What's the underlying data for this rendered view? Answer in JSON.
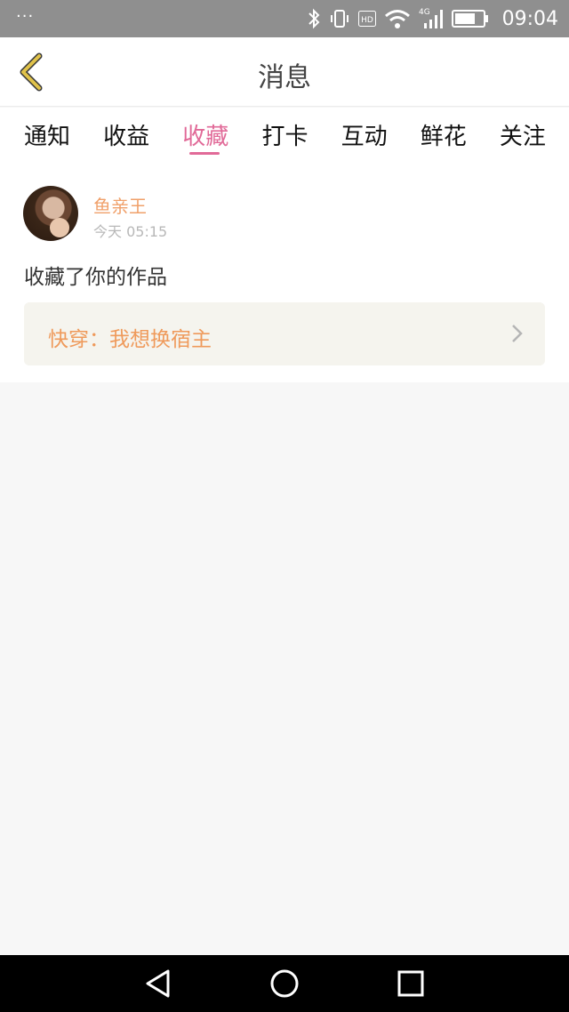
{
  "status_bar": {
    "dots": "···",
    "network": "4G",
    "hd": "HD",
    "time": "09:04"
  },
  "header": {
    "title": "消息",
    "back_icon": "chevron-left-icon"
  },
  "tabs": [
    {
      "label": "通知",
      "active": false
    },
    {
      "label": "收益",
      "active": false
    },
    {
      "label": "收藏",
      "active": true
    },
    {
      "label": "打卡",
      "active": false
    },
    {
      "label": "互动",
      "active": false
    },
    {
      "label": "鲜花",
      "active": false
    },
    {
      "label": "关注",
      "active": false
    }
  ],
  "message": {
    "user_name": "鱼亲王",
    "time": "今天 05:15",
    "action_text": "收藏了你的作品",
    "work_title": "快穿：我想换宿主"
  },
  "colors": {
    "accent": "#e16a98",
    "name": "#f0a06a",
    "work_title": "#ef9a5b",
    "back_icon": "#e0c24a"
  }
}
